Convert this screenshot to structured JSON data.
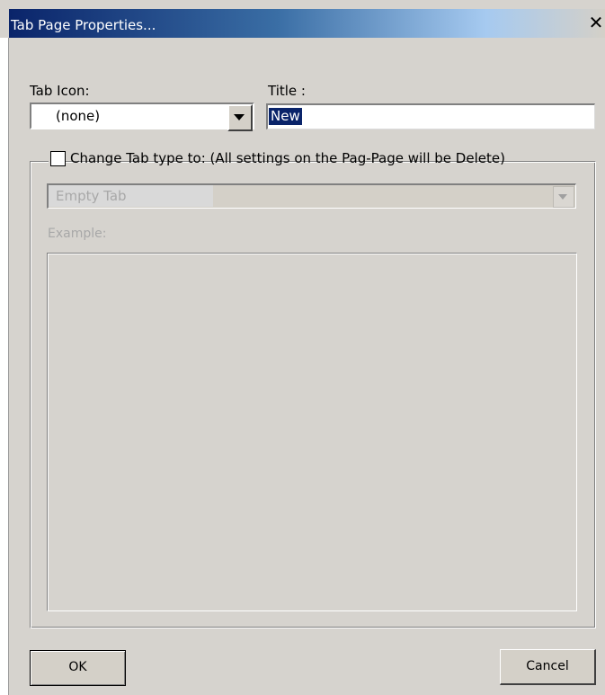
{
  "window": {
    "title": "Tab Page Properties...",
    "close_glyph": "✕"
  },
  "form": {
    "tab_icon_label": "Tab Icon:",
    "tab_icon_value": "(none)",
    "title_label": "Title :",
    "title_value": "New"
  },
  "group": {
    "checkbox_label": "Change Tab type to: (All settings on the Pag-Page will be Delete)",
    "checked": false,
    "tab_type_value": "Empty Tab",
    "example_label": "Example:"
  },
  "buttons": {
    "ok": "OK",
    "cancel": "Cancel"
  },
  "icons": {
    "close": "close-icon",
    "dropdown": "chevron-down-icon"
  },
  "colors": {
    "titlebar_start": "#0a246a",
    "dialog_bg": "#d6d3ce",
    "selection": "#0a246a"
  }
}
